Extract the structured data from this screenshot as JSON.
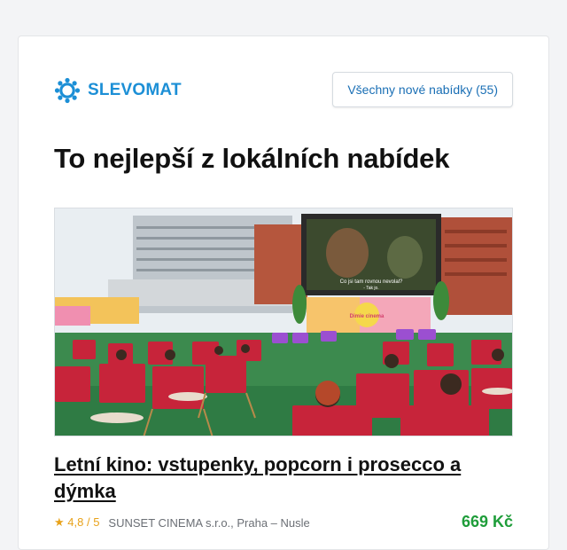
{
  "header": {
    "logo_text": "SLEVOMAT",
    "all_offers_label": "Všechny nové nabídky (55)"
  },
  "main": {
    "heading": "To nejlepší z lokálních nabídek"
  },
  "offer": {
    "title": "Letní kino: vstupenky, popcorn i prosecco a dýmka",
    "rating_star": "★",
    "rating": "4,8 / 5",
    "merchant": "SUNSET CINEMA s.r.o., Praha – Nusle",
    "price": "669 Kč",
    "image_subtitle_line1": "Co jsi tam rovnou nevolal?",
    "image_subtitle_line2": "- Tak jo.",
    "image_banner_text": "Dimie cinema"
  },
  "colors": {
    "brand": "#1c8fd6",
    "link": "#1a6fb5",
    "price": "#1f9d3a",
    "star": "#e8a21a"
  },
  "icons": {
    "logo": "gear-icon",
    "rating": "star-icon"
  }
}
